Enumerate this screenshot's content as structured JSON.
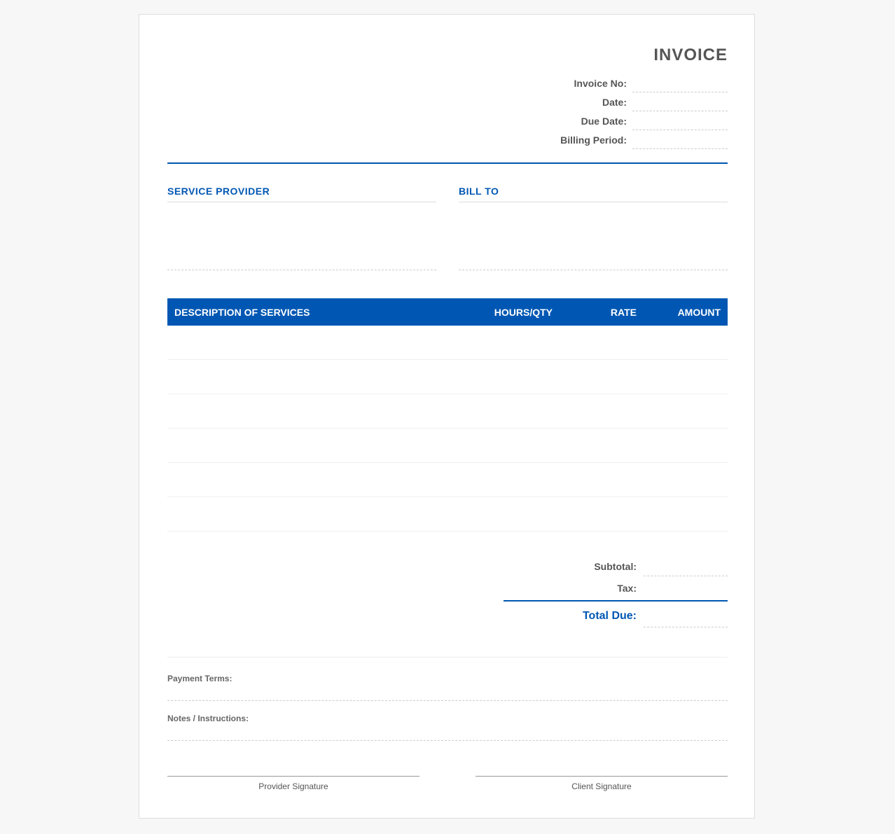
{
  "invoice": {
    "title": "INVOICE",
    "meta": [
      {
        "label": "Invoice No:",
        "value": ""
      },
      {
        "label": "Date:",
        "value": ""
      },
      {
        "label": "Due Date:",
        "value": ""
      },
      {
        "label": "Billing Period:",
        "value": ""
      }
    ]
  },
  "parties": {
    "provider_title": "SERVICE PROVIDER",
    "bill_to_title": "BILL TO"
  },
  "table": {
    "headers": [
      "DESCRIPTION OF SERVICES",
      "HOURS/QTY",
      "RATE",
      "AMOUNT"
    ],
    "rows": [
      [
        "",
        "",
        "",
        ""
      ],
      [
        "",
        "",
        "",
        ""
      ],
      [
        "",
        "",
        "",
        ""
      ],
      [
        "",
        "",
        "",
        ""
      ],
      [
        "",
        "",
        "",
        ""
      ],
      [
        "",
        "",
        "",
        ""
      ]
    ]
  },
  "totals": {
    "subtotal_label": "Subtotal:",
    "tax_label": "Tax:",
    "total_due_label": "Total Due:"
  },
  "notes": {
    "payment_terms_label": "Payment Terms:",
    "instructions_label": "Notes / Instructions:"
  },
  "signatures": {
    "provider": "Provider Signature",
    "client": "Client Signature"
  },
  "colors": {
    "accent": "#0057b3",
    "text": "#555555",
    "background": "#f7f7f7"
  }
}
